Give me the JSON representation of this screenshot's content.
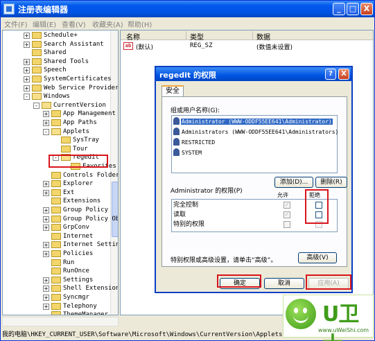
{
  "window": {
    "title": "注册表编辑器",
    "controls": [
      "_",
      "□",
      "X"
    ]
  },
  "menu": [
    "文件(F)",
    "编辑(E)",
    "查看(V)",
    "收藏夹(A)",
    "帮助(H)"
  ],
  "tree": {
    "items": [
      {
        "label": "Schedule+",
        "expand": "+"
      },
      {
        "label": "Search Assistant",
        "expand": "+"
      },
      {
        "label": "Shared",
        "expand": ""
      },
      {
        "label": "Shared Tools",
        "expand": "+"
      },
      {
        "label": "Speech",
        "expand": "+"
      },
      {
        "label": "SystemCertificates",
        "expand": "+"
      },
      {
        "label": "Web Service Providers",
        "expand": "+"
      },
      {
        "label": "Windows",
        "expand": "-"
      },
      {
        "label": "CurrentVersion",
        "expand": "-"
      },
      {
        "label": "App Management",
        "expand": "+"
      },
      {
        "label": "App Paths",
        "expand": "+"
      },
      {
        "label": "Applets",
        "expand": "-"
      },
      {
        "label": "SysTray",
        "expand": ""
      },
      {
        "label": "Tour",
        "expand": ""
      },
      {
        "label": "regedit",
        "expand": "-"
      },
      {
        "label": "Favorites",
        "expand": ""
      },
      {
        "label": "Controls Folder",
        "expand": ""
      },
      {
        "label": "Explorer",
        "expand": "+"
      },
      {
        "label": "Ext",
        "expand": "+"
      },
      {
        "label": "Extensions",
        "expand": ""
      },
      {
        "label": "Group Policy",
        "expand": "+"
      },
      {
        "label": "Group Policy Objects",
        "expand": "+"
      },
      {
        "label": "GrpConv",
        "expand": "+"
      },
      {
        "label": "Internet",
        "expand": ""
      },
      {
        "label": "Internet Settings",
        "expand": "+"
      },
      {
        "label": "Policies",
        "expand": "+"
      },
      {
        "label": "Run",
        "expand": ""
      },
      {
        "label": "RunOnce",
        "expand": ""
      },
      {
        "label": "Settings",
        "expand": "+"
      },
      {
        "label": "Shell Extensions",
        "expand": "+"
      },
      {
        "label": "Syncmgr",
        "expand": "+"
      },
      {
        "label": "Telephony",
        "expand": "+"
      },
      {
        "label": "ThemeManager",
        "expand": ""
      }
    ]
  },
  "list": {
    "columns": [
      "名称",
      "类型",
      "数据"
    ],
    "rows": [
      {
        "name": "(默认)",
        "type": "REG_SZ",
        "data": "(数值未设置)",
        "icon": "ab"
      }
    ]
  },
  "status": "我的电脑\\HKEY_CURRENT_USER\\Software\\Microsoft\\Windows\\CurrentVersion\\Applets\\regedit",
  "dialog": {
    "title": "regedit 的权限",
    "help": "?",
    "close": "X",
    "tab": "安全",
    "group_label": "组或用户名称(G):",
    "users": [
      "Administrator (WWW-ODDF55EE641\\Administrator)",
      "Administrators (WWW-ODDF55EE641\\Administrators)",
      "RESTRICTED",
      "SYSTEM"
    ],
    "add": "添加(D)...",
    "remove": "删除(R)",
    "perm_label": "Administrator 的权限(P)",
    "allow": "允许",
    "deny": "拒绝",
    "perms": [
      "完全控制",
      "读取",
      "特别的权限"
    ],
    "checkmark": "✓",
    "advanced_text": "特别权限或高级设置，请单击“高级”。",
    "advanced": "高级(V)",
    "ok": "确定",
    "cancel": "取消",
    "apply": "应用(A)"
  },
  "watermark": {
    "brand": "U卫士",
    "site": "www.uWeiShi.com"
  }
}
